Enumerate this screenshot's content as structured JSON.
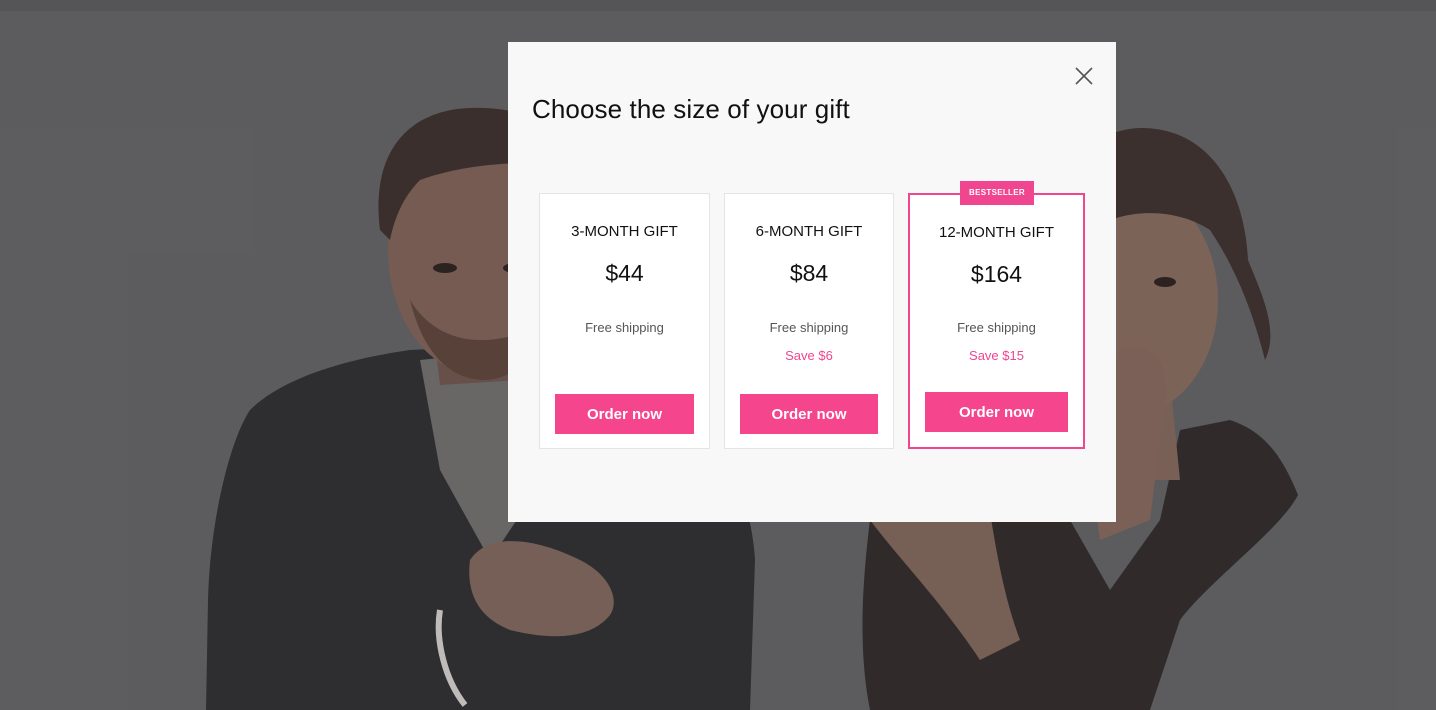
{
  "modal": {
    "title": "Choose the size of your gift",
    "close_icon": "close-icon"
  },
  "plans": [
    {
      "name": "3-MONTH GIFT",
      "price": "$44",
      "shipping": "Free shipping",
      "savings": "",
      "button": "Order now"
    },
    {
      "name": "6-MONTH GIFT",
      "price": "$84",
      "shipping": "Free shipping",
      "savings": "Save $6",
      "button": "Order now"
    },
    {
      "name": "12-MONTH GIFT",
      "price": "$164",
      "shipping": "Free shipping",
      "savings": "Save $15",
      "button": "Order now",
      "badge": "BESTSELLER"
    }
  ],
  "colors": {
    "accent": "#f5458d",
    "backdrop": "#5f5f61",
    "modal_background": "#f8f8f8"
  }
}
